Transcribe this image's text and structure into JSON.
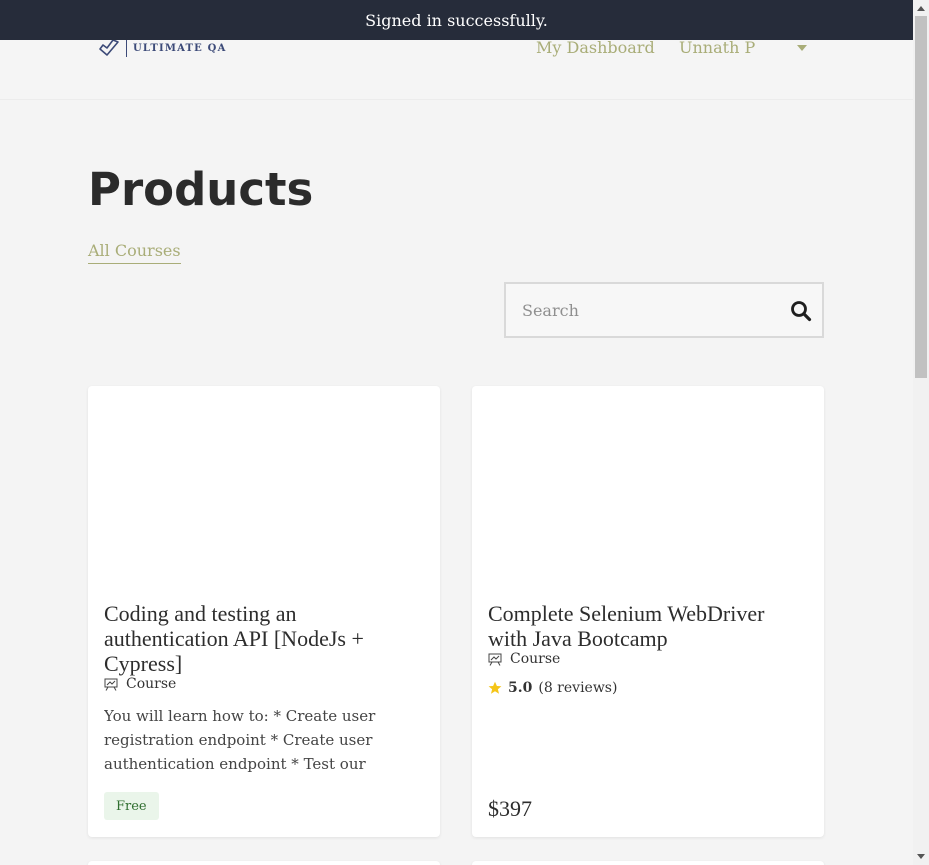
{
  "flash": {
    "message": "Signed in successfully."
  },
  "header": {
    "logo_text": "ULTIMATE QA",
    "nav": {
      "dashboard": "My Dashboard",
      "user": "Unnath P"
    }
  },
  "page": {
    "title": "Products",
    "tab_all": "All Courses"
  },
  "search": {
    "placeholder": "Search"
  },
  "products": [
    {
      "title": "Coding and testing an authentication API [NodeJs + Cypress]",
      "type": "Course",
      "description": "You will learn how to: * Create user registration endpoint * Create user authentication endpoint * Test our #API...",
      "badge": "Free"
    },
    {
      "title": "Complete Selenium WebDriver with Java Bootcamp",
      "type": "Course",
      "rating": "5.0",
      "reviews": "(8 reviews)",
      "price": "$397"
    }
  ],
  "colors": {
    "flash_bg": "#262c3a",
    "accent": "#a9ad78",
    "logo": "#3c4a78",
    "star": "#f5c518",
    "free_badge_bg": "#eaf5ea"
  },
  "icons": {
    "logo": "checkmark-tag-icon",
    "search": "search-icon",
    "course": "presentation-icon",
    "rating": "star-icon",
    "user_menu": "caret-down-icon"
  }
}
